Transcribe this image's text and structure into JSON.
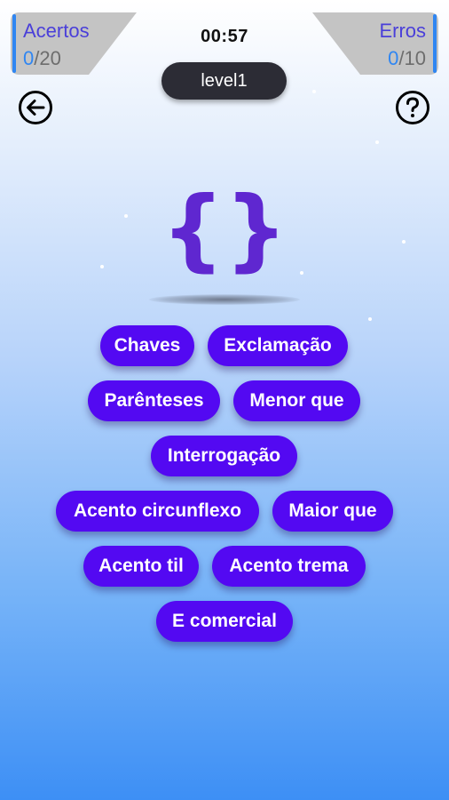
{
  "header": {
    "hits": {
      "label": "Acertos",
      "current": "0",
      "total": "/20"
    },
    "errors": {
      "label": "Erros",
      "current": "0",
      "total": "/10"
    },
    "timer": "00:57",
    "level": "level1"
  },
  "icons": {
    "back": "back-arrow-icon",
    "help": "help-question-icon"
  },
  "question": {
    "symbol": "{}"
  },
  "options": [
    "Chaves",
    "Exclamação",
    "Parênteses",
    "Menor que",
    "Interrogação",
    "Acento circunflexo",
    "Maior que",
    "Acento til",
    "Acento trema",
    "E comercial"
  ],
  "colors": {
    "option_bg": "#5309f2",
    "symbol": "#5f27d0",
    "panel_label": "#4a3fd9",
    "score_current": "#2f86f2",
    "level_pill": "#2c2c35"
  }
}
